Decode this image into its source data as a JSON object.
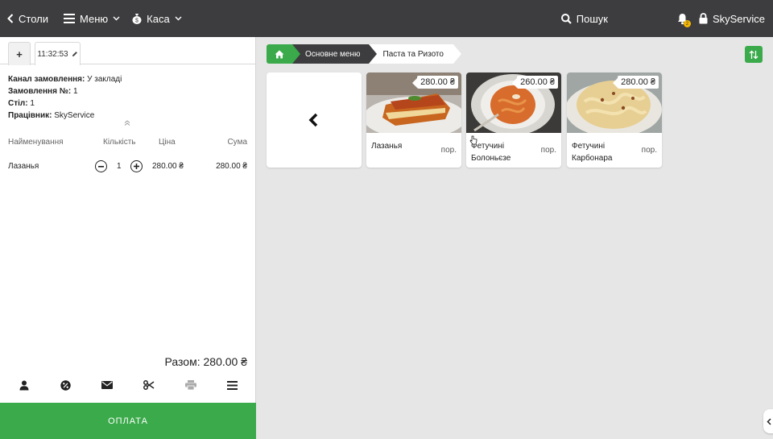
{
  "topbar": {
    "tables_label": "Столи",
    "menu_label": "Меню",
    "cash_label": "Каса",
    "search_label": "Пошук",
    "notification_count": "2",
    "user_label": "SkyService"
  },
  "order": {
    "new_tab_label": "+",
    "tab_time": "11:32:53",
    "channel_label": "Канал замовлення:",
    "channel_value": "У закладі",
    "number_label": "Замовлення №:",
    "number_value": "1",
    "table_label": "Стіл:",
    "table_value": "1",
    "employee_label": "Працівник:",
    "employee_value": "SkyService",
    "columns": {
      "name": "Найменування",
      "qty": "Кількість",
      "price": "Ціна",
      "sum": "Сума"
    },
    "items": [
      {
        "name": "Лазанья",
        "qty": "1",
        "price": "280.00 ₴",
        "sum": "280.00 ₴"
      }
    ],
    "total_label": "Разом: 280.00 ₴",
    "pay_label": "ОПЛАТА"
  },
  "breadcrumb": {
    "level1": "Основне меню",
    "level2": "Паста та Ризото"
  },
  "products": [
    {
      "name": "Лазанья",
      "price": "280.00 ₴",
      "unit": "пор."
    },
    {
      "name": "Фетучині Болоньєзе",
      "price": "260.00 ₴",
      "unit": "пор."
    },
    {
      "name": "Фетучині Карбонара",
      "price": "280.00 ₴",
      "unit": "пор."
    }
  ],
  "colors": {
    "accent": "#3aaa4b",
    "topbar": "#3d3d3f",
    "badge": "#f5b800"
  }
}
